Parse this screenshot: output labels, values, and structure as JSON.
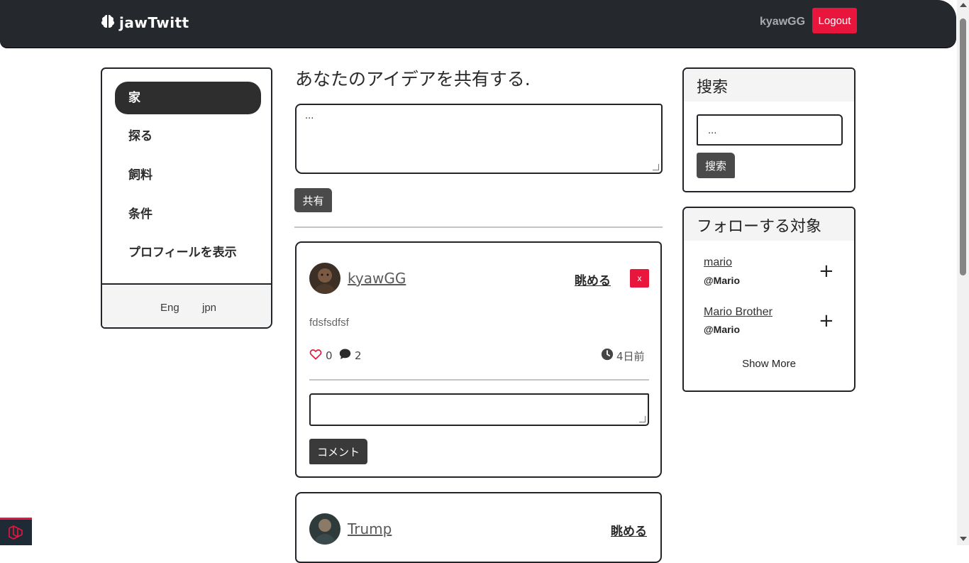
{
  "app": {
    "brand": "jawTwitt"
  },
  "navbar": {
    "username": "kyawGG",
    "logout_label": "Logout"
  },
  "sidebar": {
    "items": [
      {
        "label": "家",
        "active": true
      },
      {
        "label": "探る"
      },
      {
        "label": "飼料"
      },
      {
        "label": "条件"
      },
      {
        "label": "プロフィールを表示"
      }
    ],
    "languages": [
      "Eng",
      "jpn"
    ]
  },
  "composer": {
    "title": "あなたのアイデアを共有する.",
    "textarea_value": "...",
    "share_label": "共有"
  },
  "posts": [
    {
      "username": "kyawGG",
      "view_label": "眺める",
      "delete_label": "x",
      "text": "fdsfsdfsf",
      "likes": "0",
      "comments": "2",
      "time": "4日前",
      "comment_button_label": "コメント"
    },
    {
      "username": "Trump",
      "view_label": "眺める"
    }
  ],
  "search": {
    "title": "搜索",
    "input_value": "...",
    "button_label": "搜索"
  },
  "follow": {
    "title": "フォローする対象",
    "users": [
      {
        "name": "mario",
        "handle": "@Mario"
      },
      {
        "name": "Mario Brother",
        "handle": "@Mario"
      }
    ],
    "show_more_label": "Show More"
  },
  "colors": {
    "navbar": "#25282c",
    "accent_red": "#e8163d",
    "dark_button": "#4a4a4a"
  }
}
